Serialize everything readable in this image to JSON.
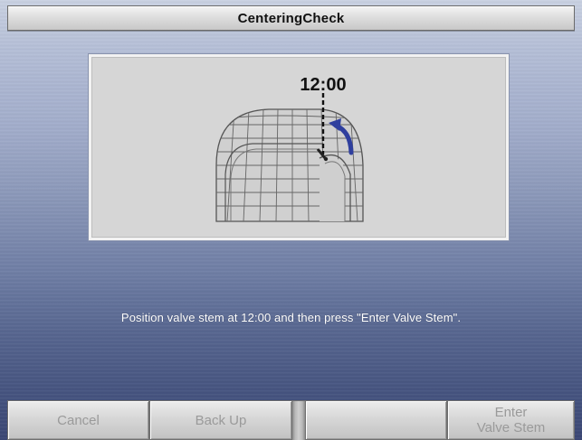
{
  "window": {
    "title": "CenteringCheck"
  },
  "illustration": {
    "clock_label": "12:00",
    "arrow_color": "#2f3f9e",
    "icons": [
      "tire-icon",
      "valve-stem-icon",
      "rotation-arrow-icon"
    ]
  },
  "instruction": {
    "text": "Position valve stem at 12:00 and then press \"Enter Valve Stem\"."
  },
  "function_keys": [
    {
      "line1": "Cancel",
      "line2": "",
      "enabled": false
    },
    {
      "line1": "Back Up",
      "line2": "",
      "enabled": false
    },
    {
      "line1": "",
      "line2": "",
      "enabled": false
    },
    {
      "line1": "Enter",
      "line2": "Valve Stem",
      "enabled": false
    }
  ]
}
